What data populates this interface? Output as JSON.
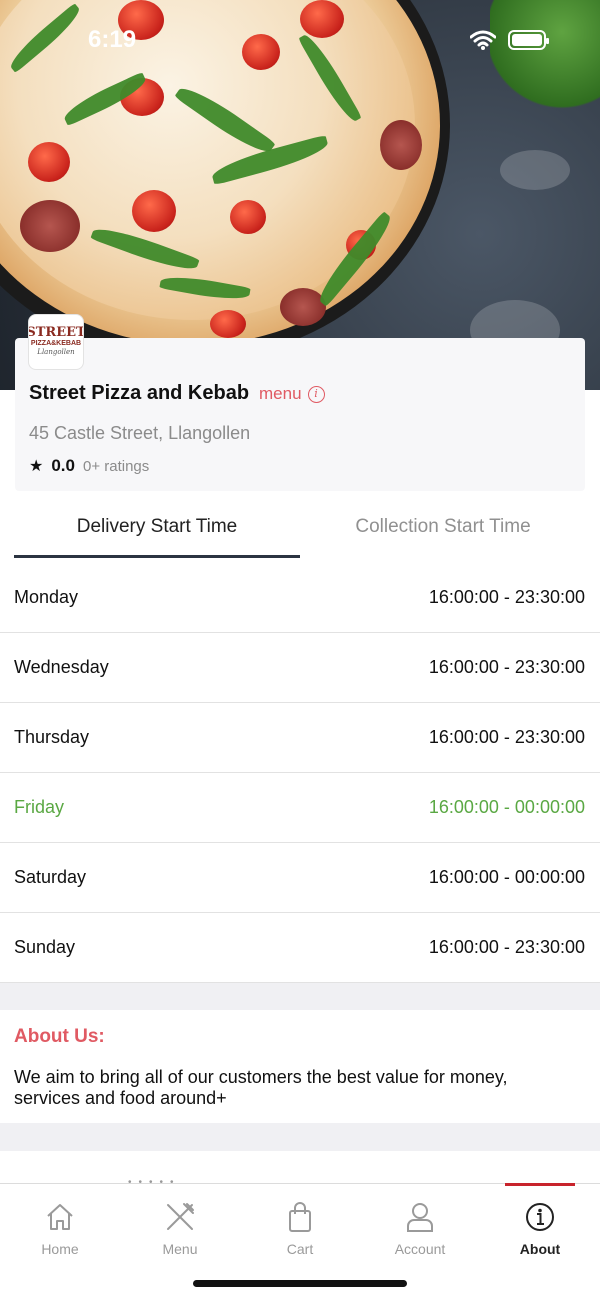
{
  "status_bar": {
    "time": "6:19"
  },
  "restaurant": {
    "logo_text": {
      "line1": "STREET",
      "line2": "PIZZA&KEBAB",
      "line3": "Llangollen"
    },
    "name": "Street Pizza and Kebab",
    "menu_link": "menu",
    "address": "45 Castle Street, Llangollen",
    "rating_value": "0.0",
    "rating_count": "0+ ratings"
  },
  "tabs": [
    {
      "label": "Delivery Start Time",
      "active": true
    },
    {
      "label": "Collection Start Time",
      "active": false
    }
  ],
  "schedule": [
    {
      "day": "Monday",
      "hours": "16:00:00 - 23:30:00"
    },
    {
      "day": "Wednesday",
      "hours": "16:00:00 - 23:30:00"
    },
    {
      "day": "Thursday",
      "hours": "16:00:00 - 23:30:00"
    },
    {
      "day": "Friday",
      "hours": "16:00:00 - 00:00:00",
      "highlight": true
    },
    {
      "day": "Saturday",
      "hours": "16:00:00 - 00:00:00"
    },
    {
      "day": "Sunday",
      "hours": "16:00:00 - 23:30:00"
    }
  ],
  "about": {
    "title": "About Us:",
    "text": "We aim to bring all of our customers the best value for money, services and food around+"
  },
  "bottom_nav": [
    {
      "label": "Home",
      "icon": "home-icon"
    },
    {
      "label": "Menu",
      "icon": "fork-knife-icon"
    },
    {
      "label": "Cart",
      "icon": "shopping-bag-icon"
    },
    {
      "label": "Account",
      "icon": "user-icon"
    },
    {
      "label": "About",
      "icon": "info-icon",
      "active": true
    }
  ],
  "colors": {
    "accent": "#e05a63",
    "today_green": "#5aa843",
    "nav_active_bar": "#c8232c"
  }
}
